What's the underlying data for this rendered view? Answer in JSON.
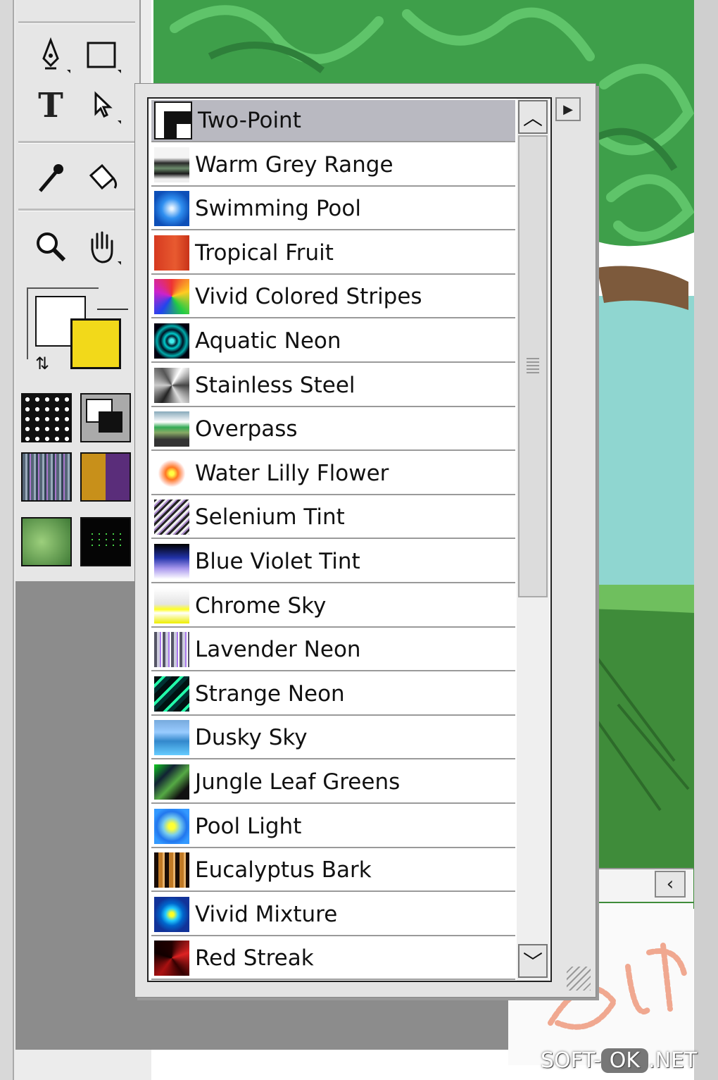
{
  "toolbox": {
    "tools": [
      {
        "name": "pen-tool",
        "icon": "pen-icon"
      },
      {
        "name": "rectangle-tool",
        "icon": "rectangle-icon"
      },
      {
        "name": "text-tool",
        "icon": "text-icon",
        "glyph": "T"
      },
      {
        "name": "selection-tool",
        "icon": "arrow-pointer-icon"
      },
      {
        "name": "eyedropper-tool",
        "icon": "eyedropper-icon"
      },
      {
        "name": "paint-bucket-tool",
        "icon": "paint-bucket-icon"
      },
      {
        "name": "zoom-tool",
        "icon": "magnifier-icon"
      },
      {
        "name": "hand-tool",
        "icon": "hand-icon"
      }
    ],
    "colors": {
      "primary": "#ffffff",
      "secondary": "#f2d91a"
    }
  },
  "gradient_menu": {
    "selected_index": 0,
    "items": [
      {
        "label": "Two-Point",
        "thumb": "two-point"
      },
      {
        "label": "Warm Grey Range",
        "thumb": "warm-grey"
      },
      {
        "label": "Swimming Pool",
        "thumb": "swimming-pool"
      },
      {
        "label": "Tropical Fruit",
        "thumb": "tropical-fruit"
      },
      {
        "label": "Vivid Colored Stripes",
        "thumb": "vivid-stripes"
      },
      {
        "label": "Aquatic Neon",
        "thumb": "aquatic-neon"
      },
      {
        "label": "Stainless Steel",
        "thumb": "stainless-steel"
      },
      {
        "label": "Overpass",
        "thumb": "overpass"
      },
      {
        "label": "Water Lilly Flower",
        "thumb": "water-lilly"
      },
      {
        "label": "Selenium Tint",
        "thumb": "selenium"
      },
      {
        "label": "Blue Violet Tint",
        "thumb": "blue-violet"
      },
      {
        "label": "Chrome Sky",
        "thumb": "chrome-sky"
      },
      {
        "label": "Lavender Neon",
        "thumb": "lavender-neon"
      },
      {
        "label": "Strange Neon",
        "thumb": "strange-neon"
      },
      {
        "label": "Dusky Sky",
        "thumb": "dusky-sky"
      },
      {
        "label": "Jungle Leaf Greens",
        "thumb": "jungle-leaf"
      },
      {
        "label": "Pool Light",
        "thumb": "pool-light"
      },
      {
        "label": "Eucalyptus Bark",
        "thumb": "eucalyptus"
      },
      {
        "label": "Vivid Mixture",
        "thumb": "vivid-mixture"
      },
      {
        "label": "Red Streak",
        "thumb": "red-streak"
      }
    ]
  },
  "watermark": {
    "left": "SOFT-",
    "mid": "OK",
    "right": ".NET"
  }
}
